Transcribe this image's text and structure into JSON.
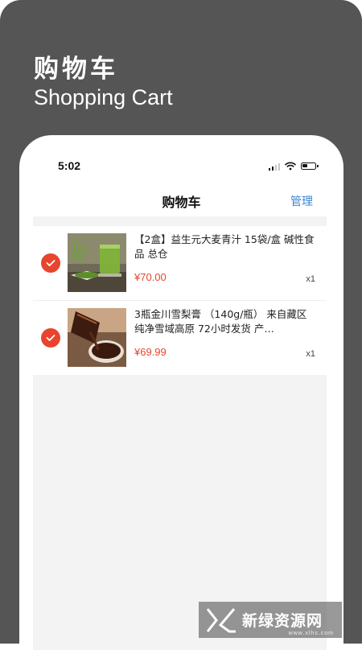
{
  "banner": {
    "title": "购物车",
    "subtitle": "Shopping Cart"
  },
  "status_bar": {
    "time": "5:02",
    "icons": [
      "signal-icon",
      "wifi-icon",
      "battery-icon"
    ]
  },
  "nav": {
    "title": "购物车",
    "manage": "管理"
  },
  "cart": {
    "items": [
      {
        "title": "【2盒】益生元大麦青汁 15袋/盒 碱性食品 总仓",
        "price": "¥70.00",
        "qty": "x1",
        "checked": true,
        "image": "barley-grass-juice-photo"
      },
      {
        "title": "3瓶金川雪梨膏 （140g/瓶） 来自藏区纯净雪域高原  72小时发货 产…",
        "price": "¥69.99",
        "qty": "x1",
        "checked": true,
        "image": "pear-syrup-photo"
      }
    ]
  },
  "watermark": {
    "text": "新绿资源网",
    "url": "www.xlhs.com"
  },
  "colors": {
    "accent": "#e8442e",
    "link": "#3a86d4",
    "banner": "#555555"
  }
}
